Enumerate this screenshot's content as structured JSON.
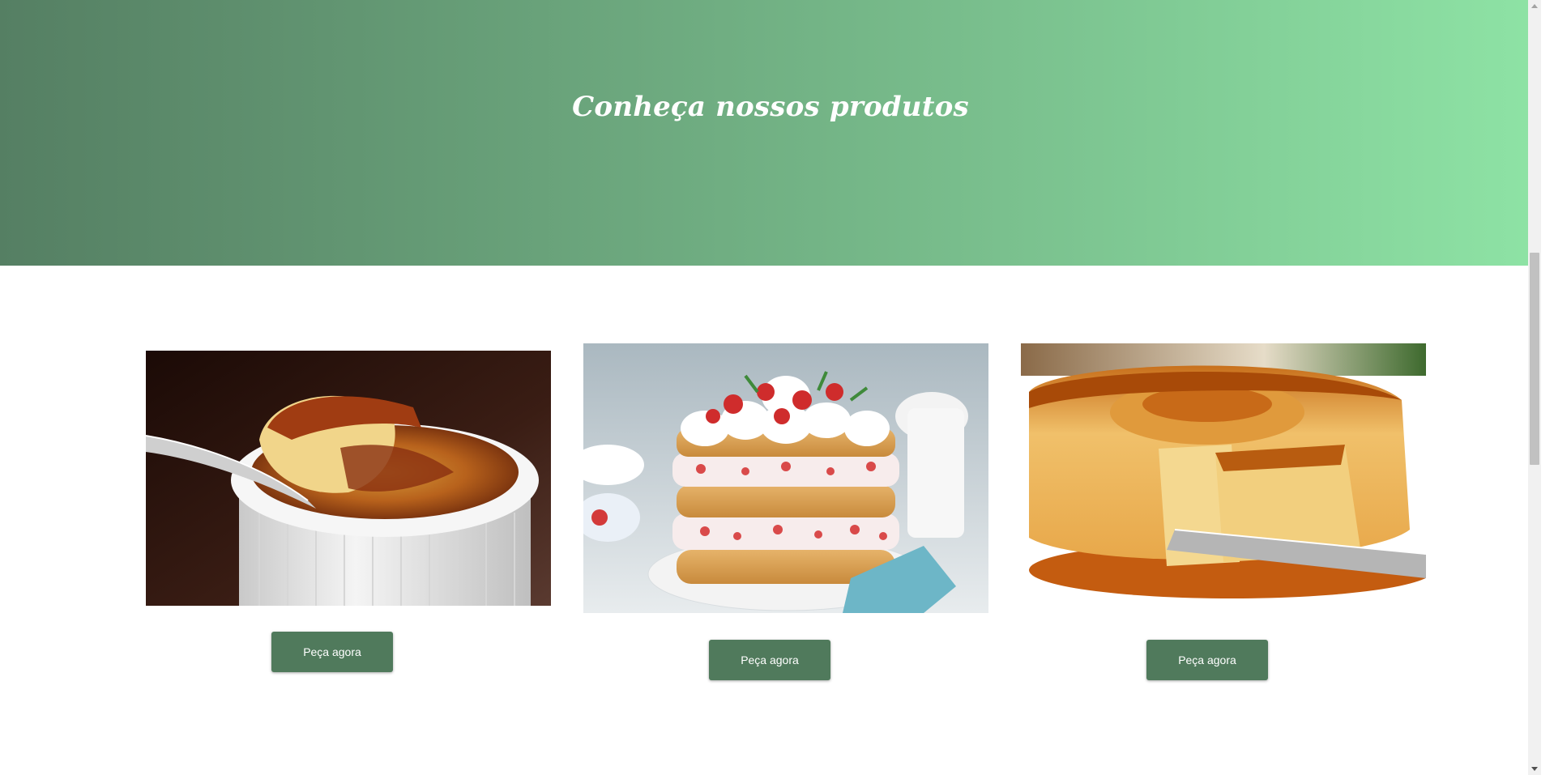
{
  "hero": {
    "title": "Conheça nossos produtos",
    "gradient_start": "#557f63",
    "gradient_end": "#8ee3a5"
  },
  "products": [
    {
      "image": "creme-brulee-photo",
      "button_label": "Peça agora"
    },
    {
      "image": "strawberry-layer-cake-photo",
      "button_label": "Peça agora"
    },
    {
      "image": "caramel-pudding-flan-photo",
      "button_label": "Peça agora"
    }
  ],
  "button_color": "#507a5c",
  "scrollbar": {
    "up_arrow": "scroll-up-icon",
    "down_arrow": "scroll-down-icon"
  }
}
